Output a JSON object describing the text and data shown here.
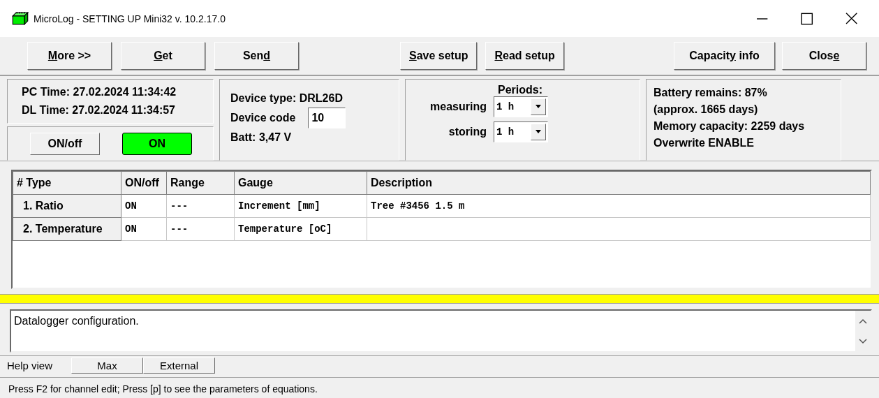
{
  "window": {
    "title": "MicroLog - SETTING UP   Mini32 v. 10.2.17.0"
  },
  "toolbar": {
    "groups": [
      [
        {
          "accel": "M",
          "after": "ore >>"
        },
        {
          "accel": "G",
          "after": "et"
        },
        {
          "before": "Sen",
          "accel": "d"
        }
      ],
      [
        {
          "accel": "S",
          "after": "ave setup"
        },
        {
          "accel": "R",
          "after": "ead setup"
        }
      ],
      [
        {
          "before": "Capacit",
          "accel": "y",
          "after": " info"
        },
        {
          "before": "Clos",
          "accel": "e"
        }
      ]
    ]
  },
  "time_panel": {
    "pc_time": "PC Time: 27.02.2024 11:34:42",
    "dl_time": "DL Time: 27.02.2024 11:34:57",
    "toggle_button": "ON/off",
    "indicator": {
      "label": "ON",
      "on": true
    }
  },
  "device_panel": {
    "device_type": "Device type: DRL26D",
    "device_code_label": "Device code",
    "device_code": "10",
    "battery": "Batt: 3,47 V"
  },
  "periods_panel": {
    "title": "Periods:",
    "rows": [
      {
        "label": "measuring",
        "value": "1 h"
      },
      {
        "label": "storing",
        "value": "1 h"
      }
    ]
  },
  "capacity_panel": {
    "lines": [
      "Battery remains: 87%",
      "(approx. 1665 days)",
      "Memory capacity: 2259 days",
      "Overwrite ENABLE"
    ]
  },
  "table": {
    "columns": [
      "#  Type",
      "ON/off",
      "Range",
      "Gauge",
      "Description"
    ],
    "rows": [
      {
        "type": "1. Ratio",
        "on_off": "ON",
        "range": "---",
        "gauge": "Increment [mm]",
        "description": "Tree #3456 1.5 m"
      },
      {
        "type": "2. Temperature",
        "on_off": "ON",
        "range": "---",
        "gauge": "Temperature [oC]",
        "description": ""
      }
    ]
  },
  "help": {
    "text": "Datalogger configuration."
  },
  "help_bar": {
    "label": "Help view",
    "buttons": [
      "Max",
      "External"
    ]
  },
  "status_bar": {
    "text": "Press F2 for channel edit; Press [p] to see the parameters of equations."
  }
}
